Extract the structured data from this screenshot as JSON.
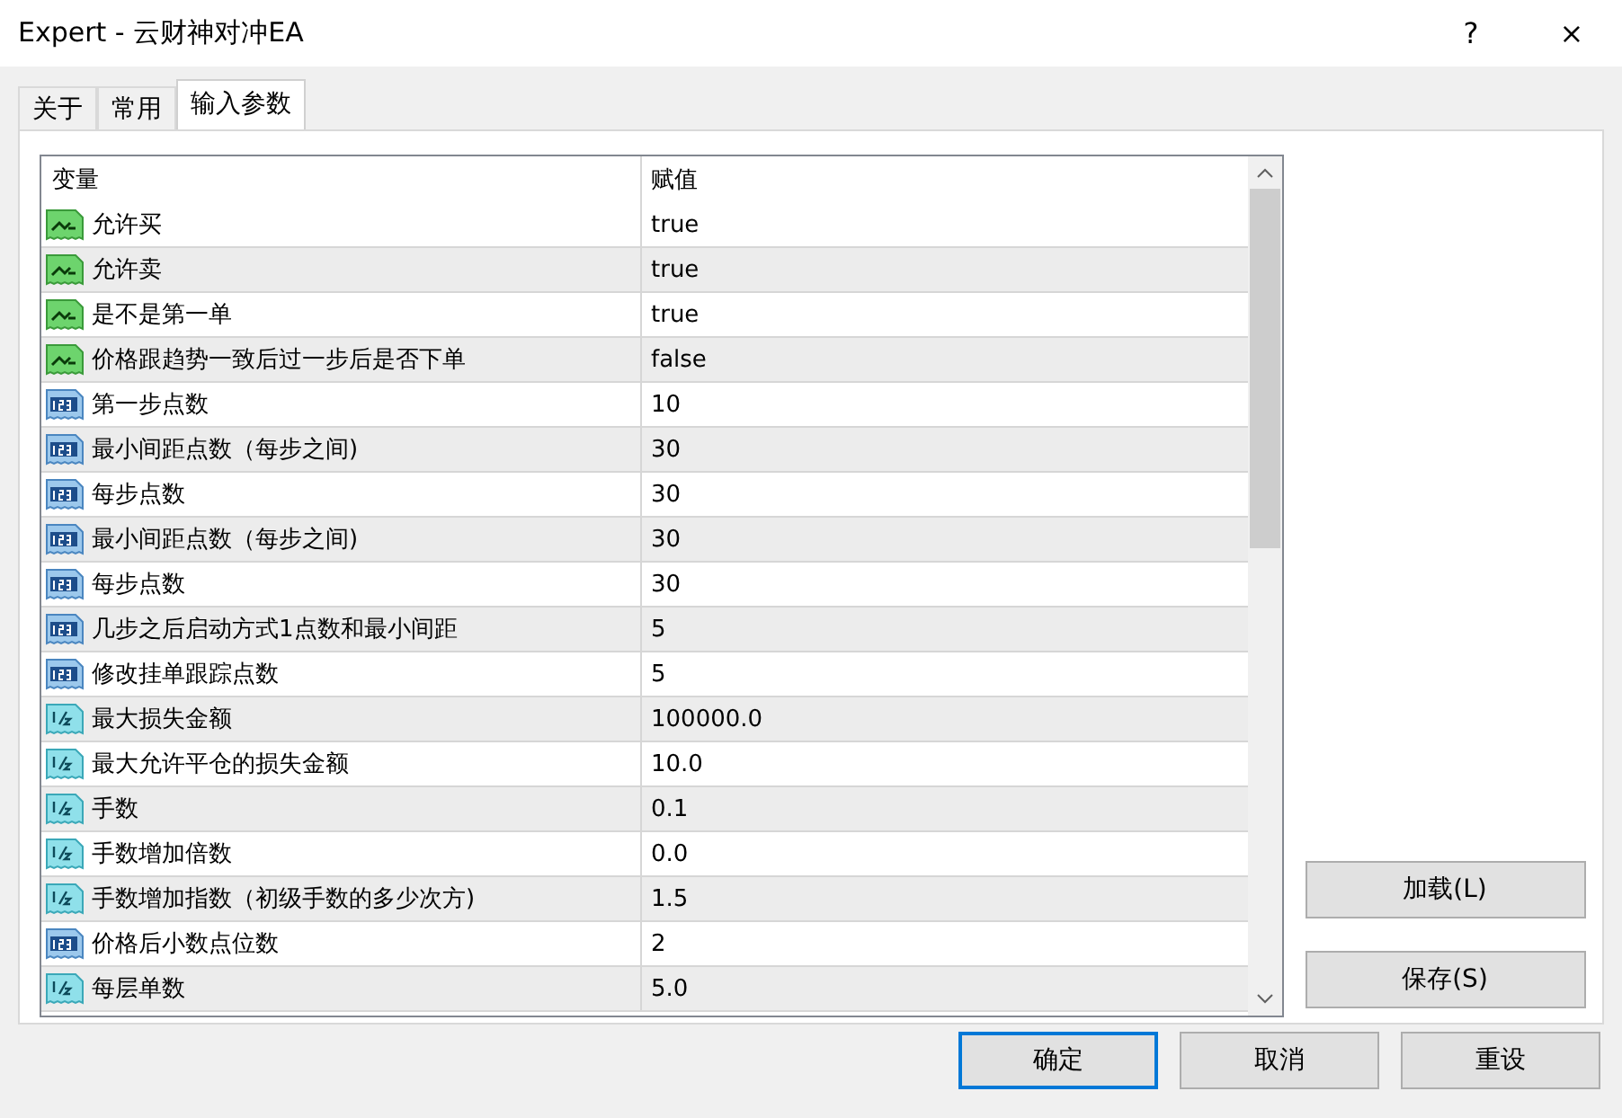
{
  "window": {
    "title": "Expert - 云财神对冲EA",
    "help": "?",
    "close": "×"
  },
  "tabs": [
    {
      "label": "关于",
      "selected": false
    },
    {
      "label": "常用",
      "selected": false
    },
    {
      "label": "输入参数",
      "selected": true
    }
  ],
  "table": {
    "columns": [
      "变量",
      "赋值"
    ],
    "rows": [
      {
        "kind": "bool",
        "name": "允许买",
        "value": "true"
      },
      {
        "kind": "bool",
        "name": "允许卖",
        "value": "true"
      },
      {
        "kind": "bool",
        "name": "是不是第一单",
        "value": "true"
      },
      {
        "kind": "bool",
        "name": "价格跟趋势一致后过一步后是否下单",
        "value": "false"
      },
      {
        "kind": "int",
        "name": "第一步点数",
        "value": "10"
      },
      {
        "kind": "int",
        "name": "最小间距点数（每步之间)",
        "value": "30"
      },
      {
        "kind": "int",
        "name": "每步点数",
        "value": "30"
      },
      {
        "kind": "int",
        "name": "最小间距点数（每步之间)",
        "value": "30"
      },
      {
        "kind": "int",
        "name": "每步点数",
        "value": "30"
      },
      {
        "kind": "int",
        "name": "几步之后启动方式1点数和最小间距",
        "value": "5"
      },
      {
        "kind": "int",
        "name": "修改挂单跟踪点数",
        "value": "5"
      },
      {
        "kind": "double",
        "name": "最大损失金额",
        "value": "100000.0"
      },
      {
        "kind": "double",
        "name": "最大允许平仓的损失金额",
        "value": "10.0"
      },
      {
        "kind": "double",
        "name": "手数",
        "value": "0.1"
      },
      {
        "kind": "double",
        "name": "手数增加倍数",
        "value": "0.0"
      },
      {
        "kind": "double",
        "name": "手数增加指数（初级手数的多少次方)",
        "value": "1.5"
      },
      {
        "kind": "int",
        "name": "价格后小数点位数",
        "value": "2"
      },
      {
        "kind": "double",
        "name": "每层单数",
        "value": "5.0"
      }
    ]
  },
  "side_buttons": [
    "加载(L)",
    "保存(S)"
  ],
  "buttons": [
    {
      "label": "确定",
      "default": true
    },
    {
      "label": "取消",
      "default": false
    },
    {
      "label": "重设",
      "default": false
    }
  ]
}
